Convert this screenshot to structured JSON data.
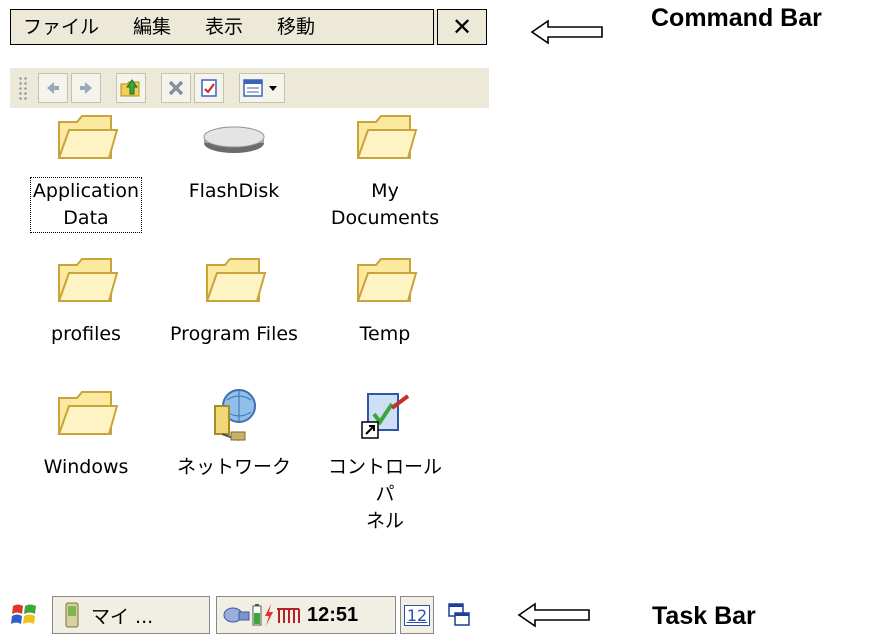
{
  "menu": {
    "items": [
      "ファイル",
      "編集",
      "表示",
      "移動"
    ],
    "close_glyph": "✕"
  },
  "toolbar": {
    "buttons": [
      "back-icon",
      "forward-icon",
      "folder-up-icon",
      "delete-icon",
      "properties-icon",
      "view-menu-icon"
    ]
  },
  "files": [
    {
      "name": "Application Data",
      "lines": [
        "Application",
        "Data"
      ],
      "icon": "folder-icon",
      "selected": true
    },
    {
      "name": "FlashDisk",
      "lines": [
        "FlashDisk"
      ],
      "icon": "flash-disk-icon"
    },
    {
      "name": "My Documents",
      "lines": [
        "My",
        "Documents"
      ],
      "icon": "folder-icon"
    },
    {
      "name": "profiles",
      "lines": [
        "profiles"
      ],
      "icon": "folder-icon"
    },
    {
      "name": "Program Files",
      "lines": [
        "Program Files"
      ],
      "icon": "folder-icon"
    },
    {
      "name": "Temp",
      "lines": [
        "Temp"
      ],
      "icon": "folder-icon"
    },
    {
      "name": "Windows",
      "lines": [
        "Windows"
      ],
      "icon": "folder-icon"
    },
    {
      "name": "ネットワーク",
      "lines": [
        "ネットワーク"
      ],
      "icon": "network-icon"
    },
    {
      "name": "コントロール パネル",
      "lines": [
        "コントロール パ",
        "ネル"
      ],
      "icon": "control-panel-shortcut-icon"
    }
  ],
  "taskbar": {
    "window_button_label": "マイ ...",
    "clock": "12:51",
    "date_badge": "12",
    "icons": [
      "start-flag-icon",
      "pda-icon",
      "network-status-icon",
      "battery-icon",
      "power-icon",
      "signal-bars-icon",
      "calendar-icon",
      "desktop-switch-icon"
    ]
  },
  "annotations": {
    "command_bar": "Command Bar",
    "task_bar": "Task Bar"
  },
  "colors": {
    "bar_background": "#ece9d8",
    "folder_fill": "#fbe9a0",
    "folder_stroke": "#c9a43a"
  }
}
